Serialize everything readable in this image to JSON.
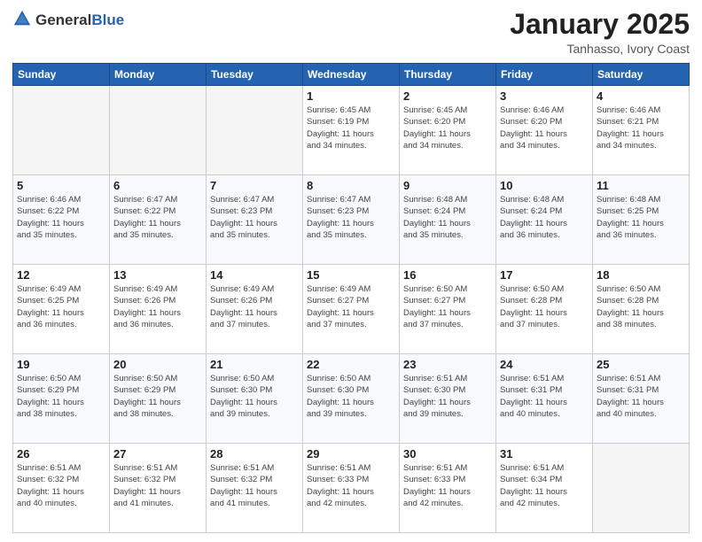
{
  "header": {
    "logo_general": "General",
    "logo_blue": "Blue",
    "month_title": "January 2025",
    "location": "Tanhasso, Ivory Coast"
  },
  "weekdays": [
    "Sunday",
    "Monday",
    "Tuesday",
    "Wednesday",
    "Thursday",
    "Friday",
    "Saturday"
  ],
  "weeks": [
    [
      {
        "day": "",
        "info": ""
      },
      {
        "day": "",
        "info": ""
      },
      {
        "day": "",
        "info": ""
      },
      {
        "day": "1",
        "info": "Sunrise: 6:45 AM\nSunset: 6:19 PM\nDaylight: 11 hours\nand 34 minutes."
      },
      {
        "day": "2",
        "info": "Sunrise: 6:45 AM\nSunset: 6:20 PM\nDaylight: 11 hours\nand 34 minutes."
      },
      {
        "day": "3",
        "info": "Sunrise: 6:46 AM\nSunset: 6:20 PM\nDaylight: 11 hours\nand 34 minutes."
      },
      {
        "day": "4",
        "info": "Sunrise: 6:46 AM\nSunset: 6:21 PM\nDaylight: 11 hours\nand 34 minutes."
      }
    ],
    [
      {
        "day": "5",
        "info": "Sunrise: 6:46 AM\nSunset: 6:22 PM\nDaylight: 11 hours\nand 35 minutes."
      },
      {
        "day": "6",
        "info": "Sunrise: 6:47 AM\nSunset: 6:22 PM\nDaylight: 11 hours\nand 35 minutes."
      },
      {
        "day": "7",
        "info": "Sunrise: 6:47 AM\nSunset: 6:23 PM\nDaylight: 11 hours\nand 35 minutes."
      },
      {
        "day": "8",
        "info": "Sunrise: 6:47 AM\nSunset: 6:23 PM\nDaylight: 11 hours\nand 35 minutes."
      },
      {
        "day": "9",
        "info": "Sunrise: 6:48 AM\nSunset: 6:24 PM\nDaylight: 11 hours\nand 35 minutes."
      },
      {
        "day": "10",
        "info": "Sunrise: 6:48 AM\nSunset: 6:24 PM\nDaylight: 11 hours\nand 36 minutes."
      },
      {
        "day": "11",
        "info": "Sunrise: 6:48 AM\nSunset: 6:25 PM\nDaylight: 11 hours\nand 36 minutes."
      }
    ],
    [
      {
        "day": "12",
        "info": "Sunrise: 6:49 AM\nSunset: 6:25 PM\nDaylight: 11 hours\nand 36 minutes."
      },
      {
        "day": "13",
        "info": "Sunrise: 6:49 AM\nSunset: 6:26 PM\nDaylight: 11 hours\nand 36 minutes."
      },
      {
        "day": "14",
        "info": "Sunrise: 6:49 AM\nSunset: 6:26 PM\nDaylight: 11 hours\nand 37 minutes."
      },
      {
        "day": "15",
        "info": "Sunrise: 6:49 AM\nSunset: 6:27 PM\nDaylight: 11 hours\nand 37 minutes."
      },
      {
        "day": "16",
        "info": "Sunrise: 6:50 AM\nSunset: 6:27 PM\nDaylight: 11 hours\nand 37 minutes."
      },
      {
        "day": "17",
        "info": "Sunrise: 6:50 AM\nSunset: 6:28 PM\nDaylight: 11 hours\nand 37 minutes."
      },
      {
        "day": "18",
        "info": "Sunrise: 6:50 AM\nSunset: 6:28 PM\nDaylight: 11 hours\nand 38 minutes."
      }
    ],
    [
      {
        "day": "19",
        "info": "Sunrise: 6:50 AM\nSunset: 6:29 PM\nDaylight: 11 hours\nand 38 minutes."
      },
      {
        "day": "20",
        "info": "Sunrise: 6:50 AM\nSunset: 6:29 PM\nDaylight: 11 hours\nand 38 minutes."
      },
      {
        "day": "21",
        "info": "Sunrise: 6:50 AM\nSunset: 6:30 PM\nDaylight: 11 hours\nand 39 minutes."
      },
      {
        "day": "22",
        "info": "Sunrise: 6:50 AM\nSunset: 6:30 PM\nDaylight: 11 hours\nand 39 minutes."
      },
      {
        "day": "23",
        "info": "Sunrise: 6:51 AM\nSunset: 6:30 PM\nDaylight: 11 hours\nand 39 minutes."
      },
      {
        "day": "24",
        "info": "Sunrise: 6:51 AM\nSunset: 6:31 PM\nDaylight: 11 hours\nand 40 minutes."
      },
      {
        "day": "25",
        "info": "Sunrise: 6:51 AM\nSunset: 6:31 PM\nDaylight: 11 hours\nand 40 minutes."
      }
    ],
    [
      {
        "day": "26",
        "info": "Sunrise: 6:51 AM\nSunset: 6:32 PM\nDaylight: 11 hours\nand 40 minutes."
      },
      {
        "day": "27",
        "info": "Sunrise: 6:51 AM\nSunset: 6:32 PM\nDaylight: 11 hours\nand 41 minutes."
      },
      {
        "day": "28",
        "info": "Sunrise: 6:51 AM\nSunset: 6:32 PM\nDaylight: 11 hours\nand 41 minutes."
      },
      {
        "day": "29",
        "info": "Sunrise: 6:51 AM\nSunset: 6:33 PM\nDaylight: 11 hours\nand 42 minutes."
      },
      {
        "day": "30",
        "info": "Sunrise: 6:51 AM\nSunset: 6:33 PM\nDaylight: 11 hours\nand 42 minutes."
      },
      {
        "day": "31",
        "info": "Sunrise: 6:51 AM\nSunset: 6:34 PM\nDaylight: 11 hours\nand 42 minutes."
      },
      {
        "day": "",
        "info": ""
      }
    ]
  ]
}
